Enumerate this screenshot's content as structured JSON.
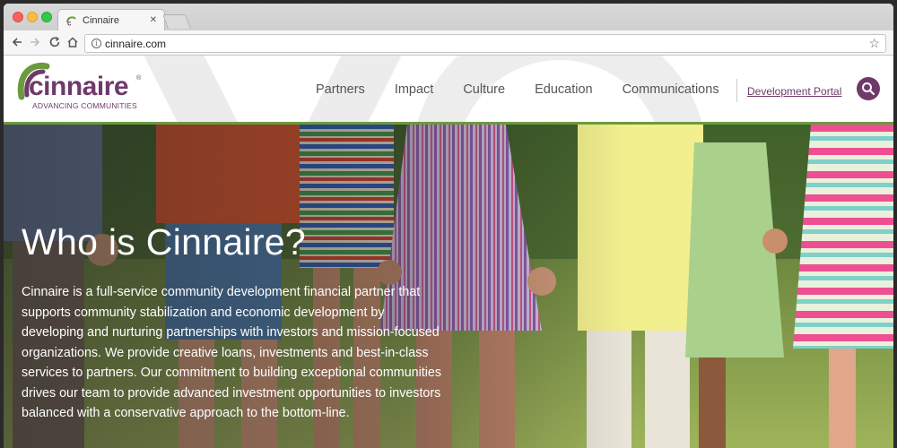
{
  "browser": {
    "tab_title": "Cinnaire",
    "tab_close": "✕",
    "url": "cinnaire.com",
    "colors": {
      "close": "#fc605c",
      "minimize": "#fdbc40",
      "maximize": "#34c84a"
    }
  },
  "site": {
    "logo_text": "cinnaire",
    "logo_registered": "®",
    "tagline": "ADVANCING COMMUNITIES",
    "nav": [
      {
        "label": "Partners"
      },
      {
        "label": "Impact"
      },
      {
        "label": "Culture"
      },
      {
        "label": "Education"
      },
      {
        "label": "Communications"
      }
    ],
    "portal_label": "Development Portal",
    "brand_color": "#6f3a6a",
    "accent_color": "#6c9a3e"
  },
  "hero": {
    "title": "Who is Cinnaire?",
    "body": "Cinnaire is a full-service community development financial partner that supports community stabilization and economic development by developing and nurturing partnerships with investors and mission-focused organizations. We provide creative loans, investments and best-in-class services to partners. Our commitment to building exceptional communities drives our team to provide advanced investment opportunities to investors balanced with a conservative approach to the bottom-line."
  },
  "icons": {
    "back": "back-arrow-icon",
    "forward": "forward-arrow-icon",
    "reload": "reload-icon",
    "home": "home-icon",
    "info": "info-icon",
    "bookmark": "star-icon",
    "search": "search-icon"
  }
}
